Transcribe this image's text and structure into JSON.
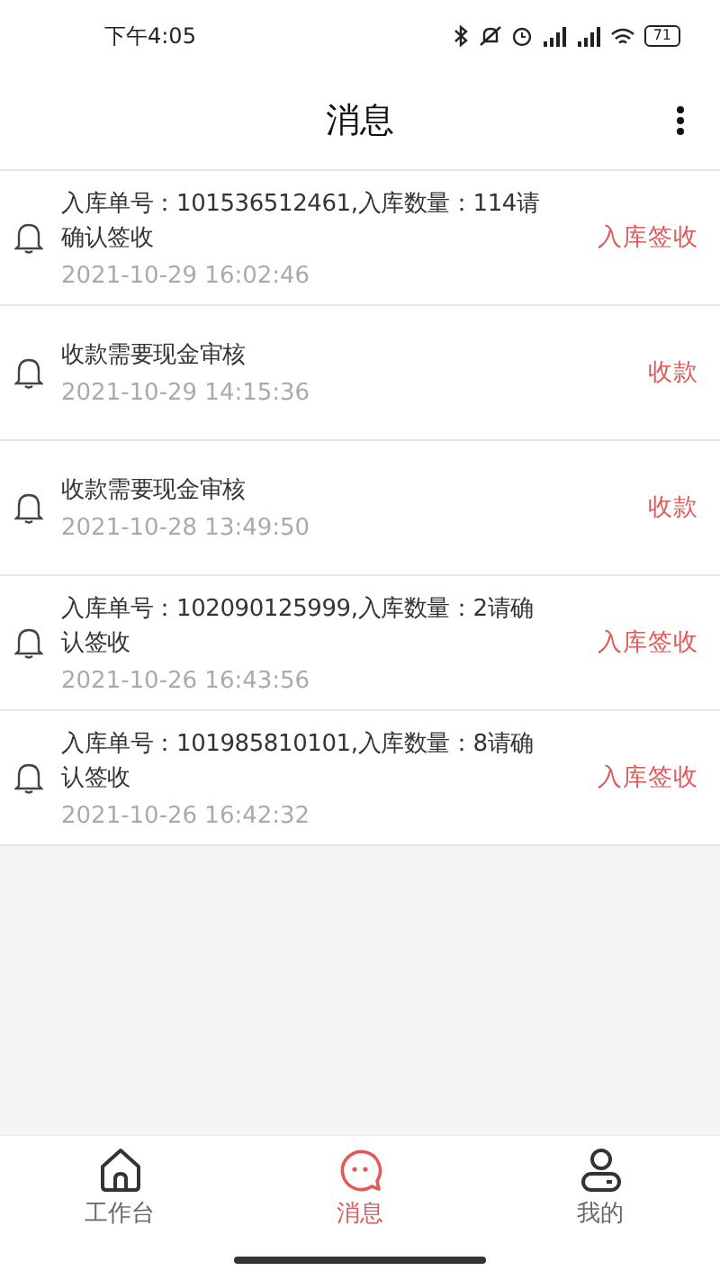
{
  "status_bar": {
    "time": "下午4:05",
    "battery": "71"
  },
  "header": {
    "title": "消息"
  },
  "messages": [
    {
      "text": "入库单号：101536512461,入库数量：114请确认签收",
      "time": "2021-10-29 16:02:46",
      "action": "入库签收"
    },
    {
      "text": "收款需要现金审核",
      "time": "2021-10-29 14:15:36",
      "action": "收款"
    },
    {
      "text": "收款需要现金审核",
      "time": "2021-10-28 13:49:50",
      "action": "收款"
    },
    {
      "text": "入库单号：102090125999,入库数量：2请确认签收",
      "time": "2021-10-26 16:43:56",
      "action": "入库签收"
    },
    {
      "text": "入库单号：101985810101,入库数量：8请确认签收",
      "time": "2021-10-26 16:42:32",
      "action": "入库签收"
    }
  ],
  "tabs": [
    {
      "kind": "home",
      "label": "工作台",
      "selected": false
    },
    {
      "kind": "chat",
      "label": "消息",
      "selected": true
    },
    {
      "kind": "user",
      "label": "我的",
      "selected": false
    }
  ]
}
